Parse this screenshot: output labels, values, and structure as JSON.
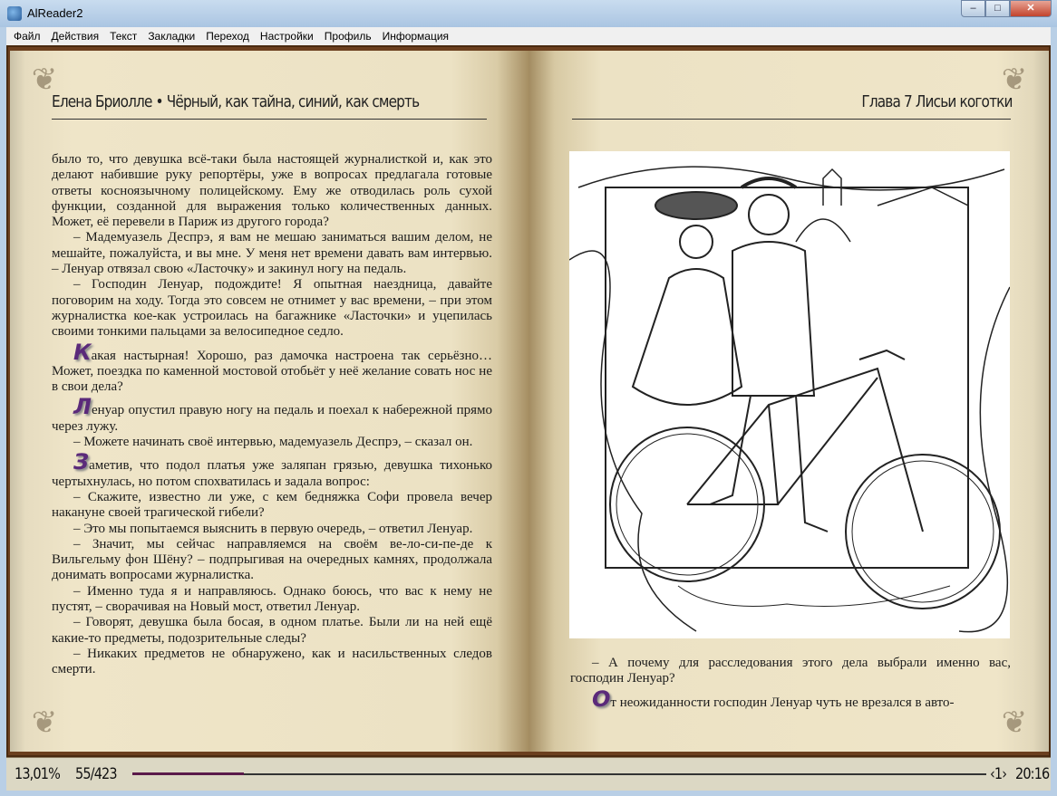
{
  "window": {
    "title": "AlReader2",
    "min": "–",
    "max": "□",
    "close": "✕"
  },
  "menu": [
    "Файл",
    "Действия",
    "Текст",
    "Закладки",
    "Переход",
    "Настройки",
    "Профиль",
    "Информация"
  ],
  "left_page": {
    "header": "Елена Бриолле  • Чёрный, как тайна, синий, как смерть",
    "paragraphs": [
      {
        "cap": "",
        "text": "было то, что девушка всё-таки была настоящей журналисткой и, как это делают набившие руку репортёры, уже в вопросах предлагала готовые ответы косноязычному полицейскому. Ему же отводилась роль сухой функции, созданной для выражения только количественных данных. Может, её перевели в Париж из другого города?",
        "noindent": true
      },
      {
        "cap": "",
        "text": "– Мадемуазель Деспрэ, я вам не мешаю заниматься вашим делом, не мешайте, пожалуйста, и вы мне. У меня нет времени давать вам интервью. – Ленуар отвязал свою «Ласточку» и закинул ногу на педаль."
      },
      {
        "cap": "",
        "text": "– Господин Ленуар, подождите! Я опытная наездница, давайте поговорим на ходу. Тогда это совсем не отнимет у вас времени, – при этом журналистка кое-как устроилась на багажнике «Ласточки» и уцепилась своими тонкими пальцами за велосипедное седло."
      },
      {
        "cap": "К",
        "text": "акая настырная! Хорошо, раз дамочка настроена так серьёзно… Может, поездка по каменной мостовой отобьёт у неё желание совать нос не в свои дела?"
      },
      {
        "cap": "Л",
        "text": "енуар опустил правую ногу на педаль и поехал к набережной прямо через лужу."
      },
      {
        "cap": "",
        "text": "– Можете начинать своё интервью, мадемуазель Деспрэ, – сказал он."
      },
      {
        "cap": "З",
        "text": "аметив, что подол платья уже заляпан грязью, девушка тихонько чертыхнулась, но потом спохватилась и задала вопрос:"
      },
      {
        "cap": "",
        "text": "– Скажите, известно ли уже, с кем бедняжка Софи провела вечер накануне своей трагической гибели?"
      },
      {
        "cap": "",
        "text": "– Это мы попытаемся выяснить в первую очередь, – ответил Ленуар."
      },
      {
        "cap": "",
        "text": "– Значит, мы сейчас направляемся на своём ве-ло-си-пе-де к Вильгельму фон Шёну? – подпрыгивая на очередных камнях, продолжала донимать вопросами журналистка."
      },
      {
        "cap": "",
        "text": "– Именно туда я и направляюсь. Однако боюсь, что вас к нему не пустят, – сворачивая на Новый мост, ответил Ленуар."
      },
      {
        "cap": "",
        "text": "– Говорят, девушка была босая, в одном платье. Были ли на ней ещё какие-то предметы, подозрительные следы?"
      },
      {
        "cap": "",
        "text": "– Никаких предметов не обнаружено, как и насильственных следов смерти."
      }
    ]
  },
  "right_page": {
    "header": "Глава 7 Лисьи коготки",
    "paragraphs": [
      {
        "cap": "",
        "text": "– А почему для расследования этого дела выбрали именно вас, господин Ленуар?"
      },
      {
        "cap": "О",
        "text": "т неожиданности господин Ленуар чуть не врезался в авто-"
      }
    ]
  },
  "status": {
    "percent": "13,01%",
    "pages": "55/423",
    "progress_fraction": 0.1301,
    "chapter": "‹1›",
    "time": "20:16"
  },
  "colors": {
    "dropcap": "#5b2a7a",
    "progress": "#5a1a4a"
  }
}
